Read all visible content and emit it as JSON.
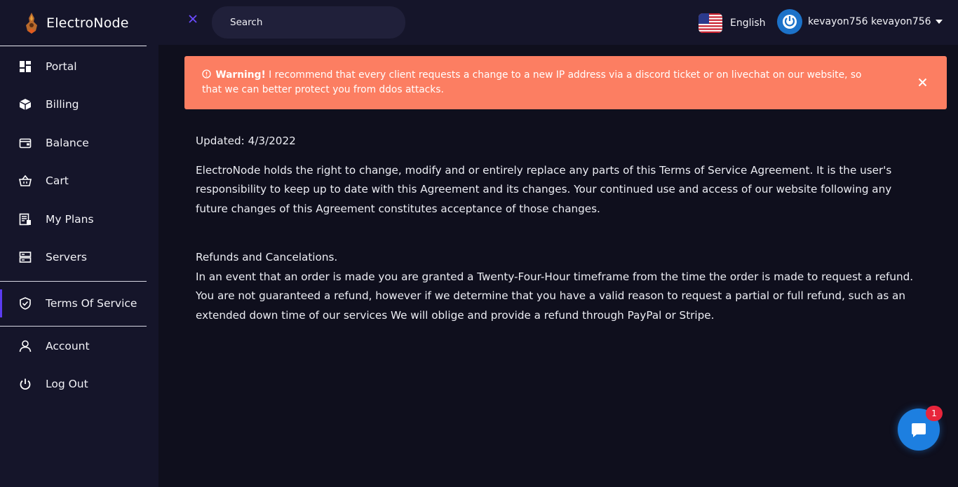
{
  "brand": {
    "name": "ElectroNode"
  },
  "sidebar": {
    "items": [
      {
        "label": "Portal",
        "icon": "dashboard-icon"
      },
      {
        "label": "Billing",
        "icon": "box-icon"
      },
      {
        "label": "Balance",
        "icon": "wallet-icon"
      },
      {
        "label": "Cart",
        "icon": "basket-icon"
      },
      {
        "label": "My Plans",
        "icon": "plans-icon"
      },
      {
        "label": "Servers",
        "icon": "server-icon"
      },
      {
        "label": "Terms Of Service",
        "icon": "shield-check-icon",
        "active": true
      },
      {
        "label": "Account",
        "icon": "user-icon"
      },
      {
        "label": "Log Out",
        "icon": "power-icon"
      }
    ]
  },
  "header": {
    "search_placeholder": "Search",
    "language": "English",
    "user_name": "kevayon756 kevayon756"
  },
  "alert": {
    "title": "Warning!",
    "message": "I recommend that every client requests a change to a new IP address via a discord ticket or on livechat on our website, so that we can better protect you from ddos attacks."
  },
  "content": {
    "updated": "Updated: 4/3/2022",
    "paragraph1": "ElectroNode holds the right to change, modify and or entirely replace any parts of this Terms of Service Agreement. It is the user's responsibility to keep up to date with this Agreement and its changes. Your continued use and access of our website following any future changes of this Agreement constitutes acceptance of those changes.",
    "refund_title": "Refunds and Cancelations.",
    "refund_text": "In an event that an order is made you are granted a Twenty-Four-Hour timeframe from the time the order is made to request a refund. You are not guaranteed a refund, however if we determine that you have a valid reason to request a partial or full refund, such as an extended down time of our services We will oblige and provide a refund through PayPal or Stripe."
  },
  "chat": {
    "badge_count": "1"
  },
  "colors": {
    "accent": "#5b3cf0",
    "alert_bg": "#fc7e62",
    "chat_blue": "#1d7fe0",
    "badge_red": "#e8253b"
  }
}
